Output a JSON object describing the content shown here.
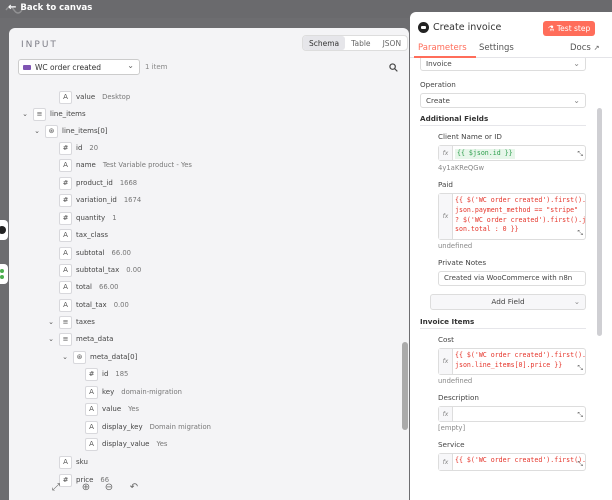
{
  "topbar": {
    "back_label": "Back to canvas"
  },
  "input_panel": {
    "title": "INPUT",
    "view_tabs": [
      "Schema",
      "Table",
      "JSON"
    ],
    "node_select": "WC order created",
    "item_count": "1 item",
    "tree": [
      {
        "badge": "A",
        "key": "value",
        "value": "Desktop"
      },
      {
        "badge": "≡",
        "key": "line_items",
        "value": ""
      },
      {
        "badge": "⊛",
        "key": "line_items[0]",
        "value": ""
      },
      {
        "badge": "#",
        "key": "id",
        "value": "20"
      },
      {
        "badge": "A",
        "key": "name",
        "value": "Test Variable product - Yes"
      },
      {
        "badge": "#",
        "key": "product_id",
        "value": "1668"
      },
      {
        "badge": "#",
        "key": "variation_id",
        "value": "1674"
      },
      {
        "badge": "#",
        "key": "quantity",
        "value": "1"
      },
      {
        "badge": "A",
        "key": "tax_class",
        "value": ""
      },
      {
        "badge": "A",
        "key": "subtotal",
        "value": "66.00"
      },
      {
        "badge": "A",
        "key": "subtotal_tax",
        "value": "0.00"
      },
      {
        "badge": "A",
        "key": "total",
        "value": "66.00"
      },
      {
        "badge": "A",
        "key": "total_tax",
        "value": "0.00"
      },
      {
        "badge": "≡",
        "key": "taxes",
        "value": ""
      },
      {
        "badge": "≡",
        "key": "meta_data",
        "value": ""
      },
      {
        "badge": "⊛",
        "key": "meta_data[0]",
        "value": ""
      },
      {
        "badge": "#",
        "key": "id",
        "value": "185"
      },
      {
        "badge": "A",
        "key": "key",
        "value": "domain-migration"
      },
      {
        "badge": "A",
        "key": "value",
        "value": "Yes"
      },
      {
        "badge": "A",
        "key": "display_key",
        "value": "Domain migration"
      },
      {
        "badge": "A",
        "key": "display_value",
        "value": "Yes"
      },
      {
        "badge": "A",
        "key": "sku",
        "value": ""
      },
      {
        "badge": "#",
        "key": "price",
        "value": "66"
      }
    ]
  },
  "node_panel": {
    "title": "Create invoice",
    "test_button": "Test step",
    "tabs": {
      "parameters": "Parameters",
      "settings": "Settings",
      "docs": "Docs"
    },
    "resource_value": "Invoice",
    "operation_label": "Operation",
    "operation_value": "Create",
    "additional_fields_label": "Additional Fields",
    "client_label": "Client Name or ID",
    "client_expr": "{{ $json.id }}",
    "client_hint": "4y1aKReQGw",
    "paid_label": "Paid",
    "paid_expr": "{{ $('WC order created').first().\njson.payment_method == \"stripe\"\n? $('WC order created').first().j\nson.total : 0 }}",
    "paid_hint": "undefined",
    "notes_label": "Private Notes",
    "notes_value": "Created via WooCommerce with n8n",
    "add_field": "Add Field",
    "invoice_items_label": "Invoice Items",
    "cost_label": "Cost",
    "cost_expr": "{{ $('WC order created').first().\njson.line_items[0].price }}",
    "cost_hint": "undefined",
    "desc_label": "Description",
    "desc_hint": "[empty]",
    "service_label": "Service",
    "service_expr": "{{ $('WC order created').first()."
  }
}
